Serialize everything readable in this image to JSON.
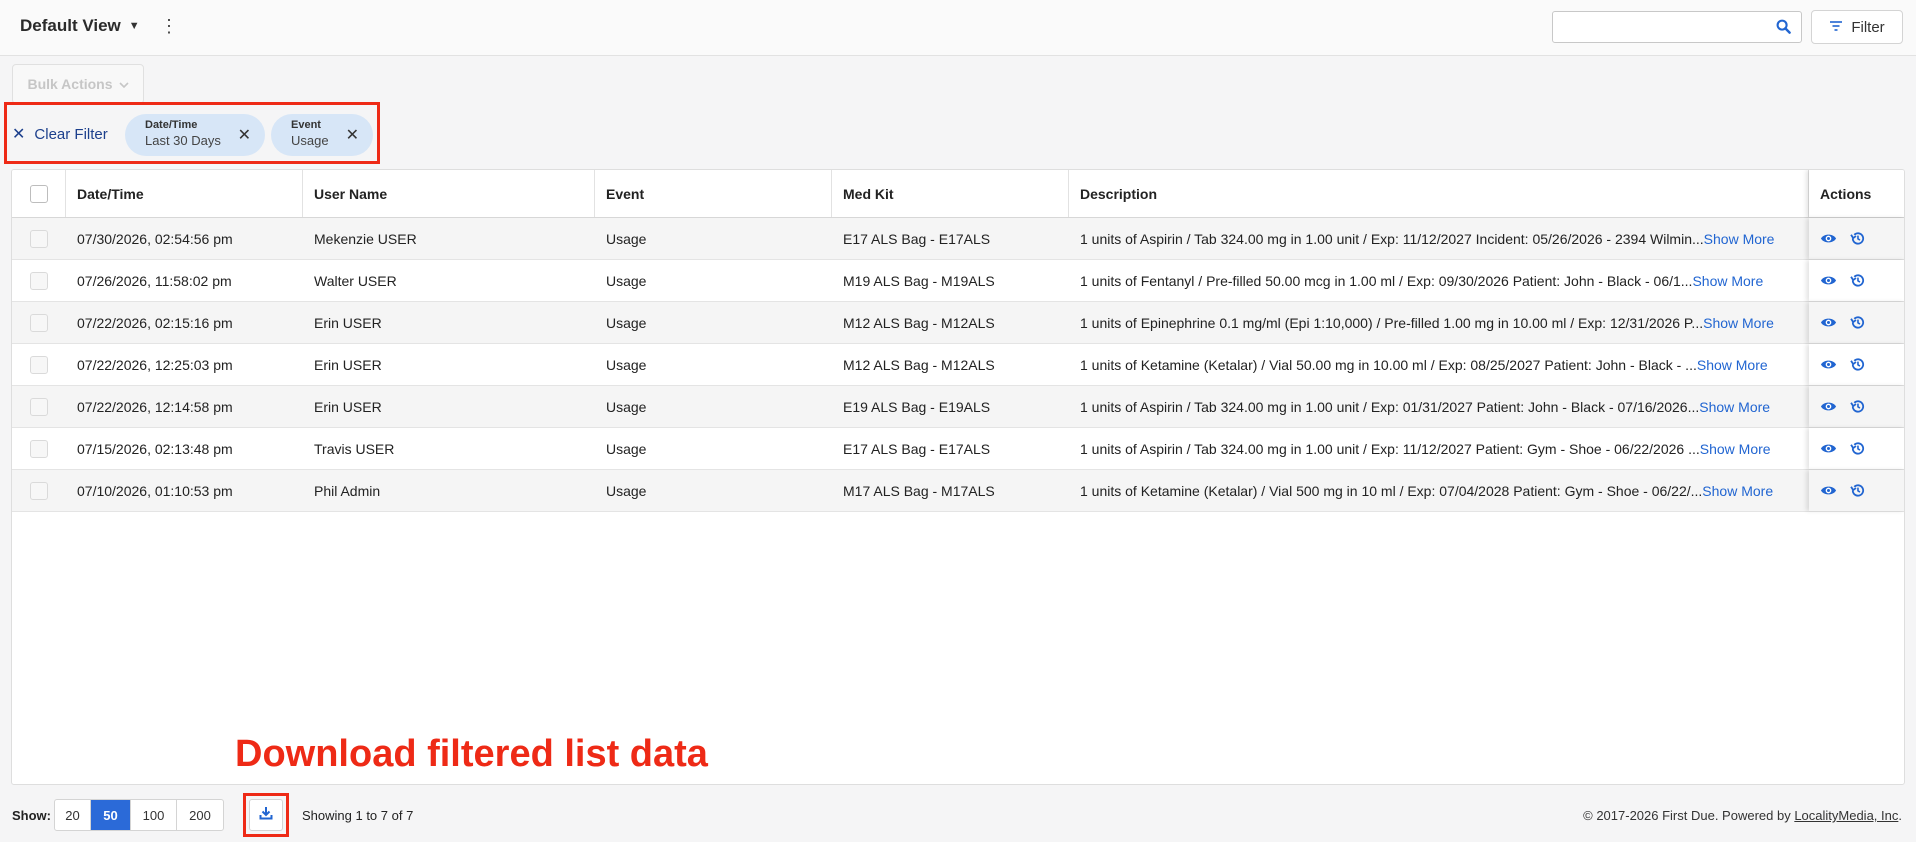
{
  "header": {
    "view_title": "Default View",
    "search": {
      "value": "",
      "placeholder": ""
    },
    "filter_label": "Filter"
  },
  "bulk_actions_label": "Bulk Actions",
  "filters": {
    "clear_label": "Clear Filter",
    "chips": [
      {
        "label": "Date/Time",
        "value": "Last 30 Days"
      },
      {
        "label": "Event",
        "value": "Usage"
      }
    ]
  },
  "table": {
    "columns": [
      "Date/Time",
      "User Name",
      "Event",
      "Med Kit",
      "Description",
      "Actions"
    ],
    "show_more_label": "Show More",
    "rows": [
      {
        "datetime": "07/30/2026, 02:54:56 pm",
        "user": "Mekenzie USER",
        "event": "Usage",
        "medkit": "E17 ALS Bag - E17ALS",
        "description": "1 units of Aspirin / Tab 324.00 mg in 1.00 unit / Exp: 11/12/2027 Incident: 05/26/2026 - 2394 Wilmin..."
      },
      {
        "datetime": "07/26/2026, 11:58:02 pm",
        "user": "Walter USER",
        "event": "Usage",
        "medkit": "M19 ALS Bag - M19ALS",
        "description": "1 units of Fentanyl / Pre-filled 50.00 mcg in 1.00 ml / Exp: 09/30/2026 Patient: John - Black - 06/1..."
      },
      {
        "datetime": "07/22/2026, 02:15:16 pm",
        "user": "Erin USER",
        "event": "Usage",
        "medkit": "M12 ALS Bag - M12ALS",
        "description": "1 units of Epinephrine 0.1 mg/ml (Epi 1:10,000) / Pre-filled 1.00 mg in 10.00 ml / Exp: 12/31/2026 P..."
      },
      {
        "datetime": "07/22/2026, 12:25:03 pm",
        "user": "Erin USER",
        "event": "Usage",
        "medkit": "M12 ALS Bag - M12ALS",
        "description": "1 units of Ketamine (Ketalar) / Vial 50.00 mg in 10.00 ml / Exp: 08/25/2027 Patient: John - Black - ..."
      },
      {
        "datetime": "07/22/2026, 12:14:58 pm",
        "user": "Erin USER",
        "event": "Usage",
        "medkit": "E19 ALS Bag - E19ALS",
        "description": "1 units of Aspirin / Tab 324.00 mg in 1.00 unit / Exp: 01/31/2027 Patient: John - Black - 07/16/2026..."
      },
      {
        "datetime": "07/15/2026, 02:13:48 pm",
        "user": "Travis USER",
        "event": "Usage",
        "medkit": "E17 ALS Bag - E17ALS",
        "description": "1 units of Aspirin / Tab 324.00 mg in 1.00 unit / Exp: 11/12/2027 Patient: Gym  - Shoe - 06/22/2026 ..."
      },
      {
        "datetime": "07/10/2026, 01:10:53 pm",
        "user": "Phil Admin",
        "event": "Usage",
        "medkit": "M17 ALS Bag - M17ALS",
        "description": "1 units of Ketamine (Ketalar) / Vial 500 mg in 10 ml / Exp: 07/04/2028 Patient: Gym  - Shoe - 06/22/..."
      }
    ]
  },
  "annotation": "Download filtered list data",
  "footer": {
    "show_label": "Show:",
    "page_sizes": [
      "20",
      "50",
      "100",
      "200"
    ],
    "selected_page_size": "50",
    "showing_text": "Showing 1 to 7 of 7",
    "copyright_prefix": "© 2017-2026 First Due. Powered by ",
    "copyright_link": "LocalityMedia, Inc",
    "copyright_suffix": "."
  },
  "colors": {
    "accent": "#2165d1",
    "active_page": "#2b6ad8",
    "annotation": "#ee2a16",
    "chip_bg": "#d7e6f7"
  },
  "icons": [
    "caret-down-icon",
    "kebab-menu-icon",
    "search-icon",
    "filter-icon",
    "chevron-down-icon",
    "close-icon",
    "eye-icon",
    "history-icon",
    "download-icon"
  ]
}
